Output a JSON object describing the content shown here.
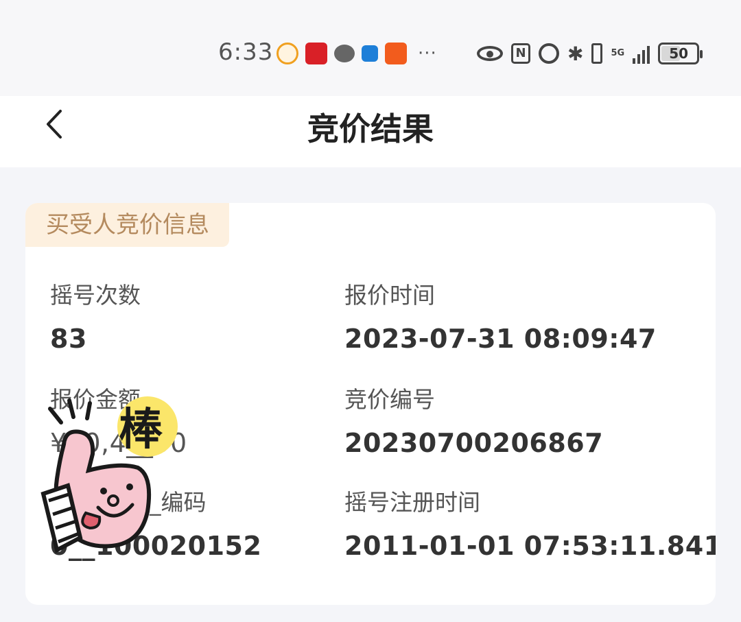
{
  "status_bar": {
    "time": "6:33",
    "notification_icons": [
      "app-icon",
      "app-icon",
      "wechat-icon",
      "app-icon",
      "taobao-icon"
    ],
    "more": "···",
    "network": "5G",
    "battery": "50",
    "battery_level": 0.5
  },
  "header": {
    "title": "竞价结果"
  },
  "card": {
    "section_tag": "买受人竞价信息",
    "fields": [
      {
        "label": "摇号次数",
        "value": "83"
      },
      {
        "label": "报价时间",
        "value": "2023-07-31 08:09:47"
      },
      {
        "label": "报价金额",
        "value": "¥30,4__00"
      },
      {
        "label": "竞价编号",
        "value": "20230700206867"
      },
      {
        "label": "_编码",
        "value": "0__100020152"
      },
      {
        "label": "摇号注册时间",
        "value": "2011-01-01 07:53:11.841"
      }
    ]
  },
  "sticker": {
    "text": "棒"
  }
}
